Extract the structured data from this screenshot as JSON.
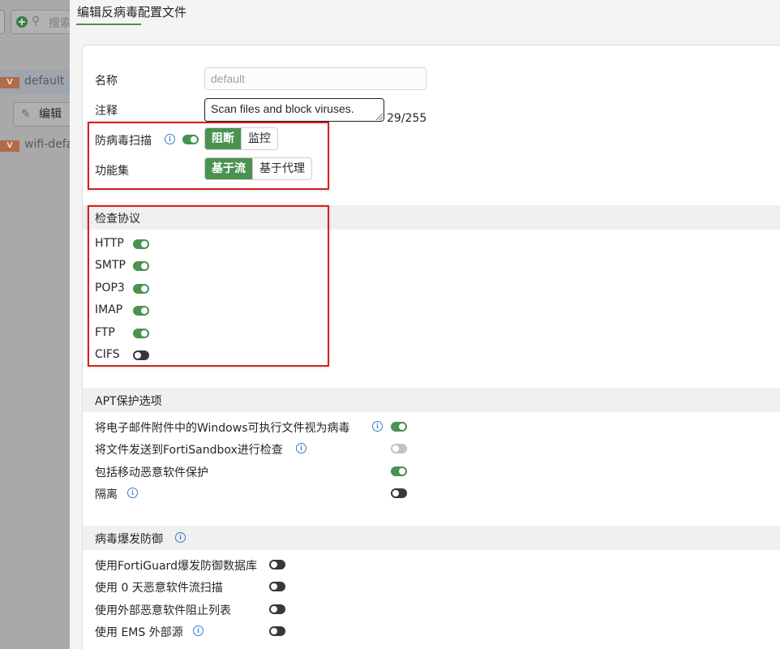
{
  "background_list": {
    "search_placeholder": "搜索",
    "edit_label": "编辑",
    "rows": [
      {
        "tag": "V",
        "name": "default"
      },
      {
        "tag": "V",
        "name": "wifi-default"
      }
    ]
  },
  "panel": {
    "title": "编辑反病毒配置文件"
  },
  "form": {
    "name_label": "名称",
    "name_value": "default",
    "comment_label": "注释",
    "comment_value": "Scan files and block viruses.",
    "comment_counter": "29/255",
    "av_scan_label": "防病毒扫描",
    "av_scan_enabled": true,
    "av_scan_modes": [
      "阻断",
      "监控"
    ],
    "av_scan_selected": "阻断",
    "feature_set_label": "功能集",
    "feature_set_modes": [
      "基于流",
      "基于代理"
    ],
    "feature_set_selected": "基于流"
  },
  "protocols": {
    "title": "检查协议",
    "items": [
      {
        "name": "HTTP",
        "enabled": true
      },
      {
        "name": "SMTP",
        "enabled": true
      },
      {
        "name": "POP3",
        "enabled": true
      },
      {
        "name": "IMAP",
        "enabled": true
      },
      {
        "name": "FTP",
        "enabled": true
      },
      {
        "name": "CIFS",
        "enabled": false
      }
    ]
  },
  "apt": {
    "title": "APT保护选项",
    "items": [
      {
        "label": "将电子邮件附件中的Windows可执行文件视为病毒",
        "info": true,
        "state": "on"
      },
      {
        "label": "将文件发送到FortiSandbox进行检查",
        "info": true,
        "state": "disabled"
      },
      {
        "label": "包括移动恶意软件保护",
        "info": false,
        "state": "on"
      },
      {
        "label": "隔离",
        "info": true,
        "state": "off"
      }
    ]
  },
  "outbreak": {
    "title": "病毒爆发防御",
    "items": [
      {
        "label": "使用FortiGuard爆发防御数据库",
        "info": false,
        "state": "off"
      },
      {
        "label": "使用 0 天恶意软件流扫描",
        "info": false,
        "state": "off"
      },
      {
        "label": "使用外部恶意软件阻止列表",
        "info": false,
        "state": "off"
      },
      {
        "label": "使用 EMS 外部源",
        "info": true,
        "state": "off"
      }
    ]
  },
  "colors": {
    "accent_green": "#4a9152",
    "highlight_red": "#d62020",
    "info_blue": "#3a77c8"
  }
}
